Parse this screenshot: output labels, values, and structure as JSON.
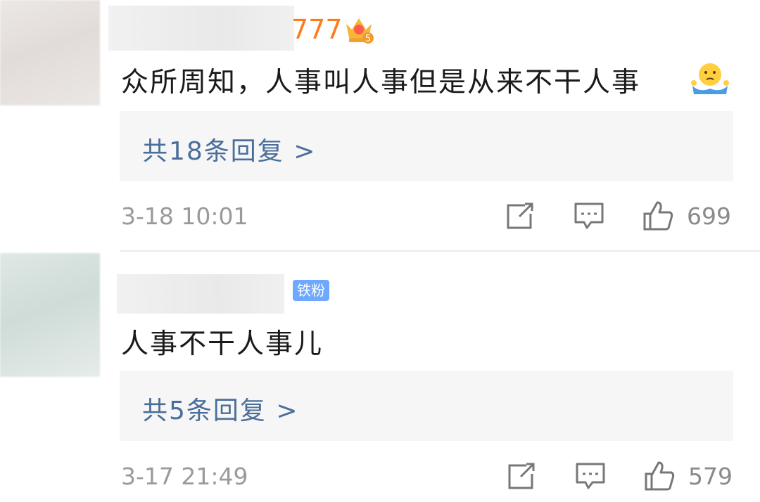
{
  "comments": [
    {
      "username_visible": "777",
      "text": "众所周知，人事叫人事但是从来不干人事",
      "emoji_icon": "shrug-emoji-icon",
      "badge_icon": "crown-level-5-icon",
      "replies_link": "共18条回复 >",
      "timestamp": "3-18 10:01",
      "likes": "699"
    },
    {
      "badge": "铁粉",
      "text": "人事不干人事儿",
      "replies_link": "共5条回复 >",
      "timestamp": "3-17 21:49",
      "likes": "579"
    }
  ],
  "colors": {
    "link": "#4a6e9a",
    "username_accent": "#ff7a1f",
    "badge_bg": "#6fa8ff",
    "meta": "#9a9a9a"
  }
}
